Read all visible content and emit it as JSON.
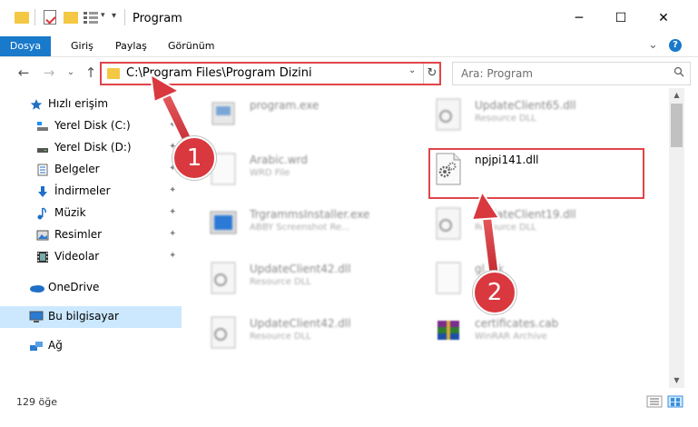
{
  "window": {
    "title": "Program",
    "minimize_glyph": "─",
    "maximize_glyph": "☐",
    "close_glyph": "✕"
  },
  "ribbon": {
    "tabs": [
      {
        "label": "Dosya"
      },
      {
        "label": "Giriş"
      },
      {
        "label": "Paylaş"
      },
      {
        "label": "Görünüm"
      }
    ],
    "collapse_glyph": "⌄",
    "help_glyph": "?"
  },
  "address": {
    "path": "C:\\Program Files\\Program Dizini",
    "dropdown_glyph": "⌄",
    "refresh_glyph": "↻"
  },
  "search": {
    "placeholder": "Ara: Program"
  },
  "nav_buttons": {
    "back": "←",
    "forward": "→",
    "recent": "⌄",
    "up": "↑"
  },
  "sidebar": {
    "items": [
      {
        "label": "Hızlı erişim",
        "icon": "star-icon",
        "pinned": false
      },
      {
        "label": "Yerel Disk (C:)",
        "icon": "drive-icon",
        "pinned": true
      },
      {
        "label": "Yerel Disk (D:)",
        "icon": "drive-icon",
        "pinned": true
      },
      {
        "label": "Belgeler",
        "icon": "documents-icon",
        "pinned": true
      },
      {
        "label": "İndirmeler",
        "icon": "download-icon",
        "pinned": true
      },
      {
        "label": "Müzik",
        "icon": "music-icon",
        "pinned": true
      },
      {
        "label": "Resimler",
        "icon": "pictures-icon",
        "pinned": true
      },
      {
        "label": "Videolar",
        "icon": "videos-icon",
        "pinned": true
      },
      {
        "label": "OneDrive",
        "icon": "cloud-icon",
        "pinned": false
      },
      {
        "label": "Bu bilgisayar",
        "icon": "computer-icon",
        "pinned": false,
        "selected": true
      },
      {
        "label": "Ağ",
        "icon": "network-icon",
        "pinned": false
      }
    ],
    "pin_glyph": "📌"
  },
  "files": [
    {
      "name": "program.exe",
      "type": ""
    },
    {
      "name": "UpdateClient65.dll",
      "type": "Resource DLL"
    },
    {
      "name": "Arabic.wrd",
      "type": "WRD File"
    },
    {
      "name": "npjpi141.dll",
      "type": ""
    },
    {
      "name": "TrgrammsInstaller.exe",
      "type": "ABBY Screenshot Re..."
    },
    {
      "name": "UpdateClient19.dll",
      "type": "Resource DLL"
    },
    {
      "name": "UpdateClient42.dll",
      "type": "Resource DLL"
    },
    {
      "name": "gl..ck",
      "type": ""
    },
    {
      "name": "UpdateClient42.dll",
      "type": "Resource DLL"
    },
    {
      "name": "certificates.cab",
      "type": "WinRAR Archive"
    }
  ],
  "status": {
    "count": "129 öğe"
  },
  "callouts": [
    {
      "label": "1"
    },
    {
      "label": "2"
    }
  ],
  "colors": {
    "accent": "#1979ca",
    "highlight_red": "#e0454a",
    "callout_red": "#d9383e",
    "selection": "#cce8ff",
    "folder": "#f4c842"
  }
}
